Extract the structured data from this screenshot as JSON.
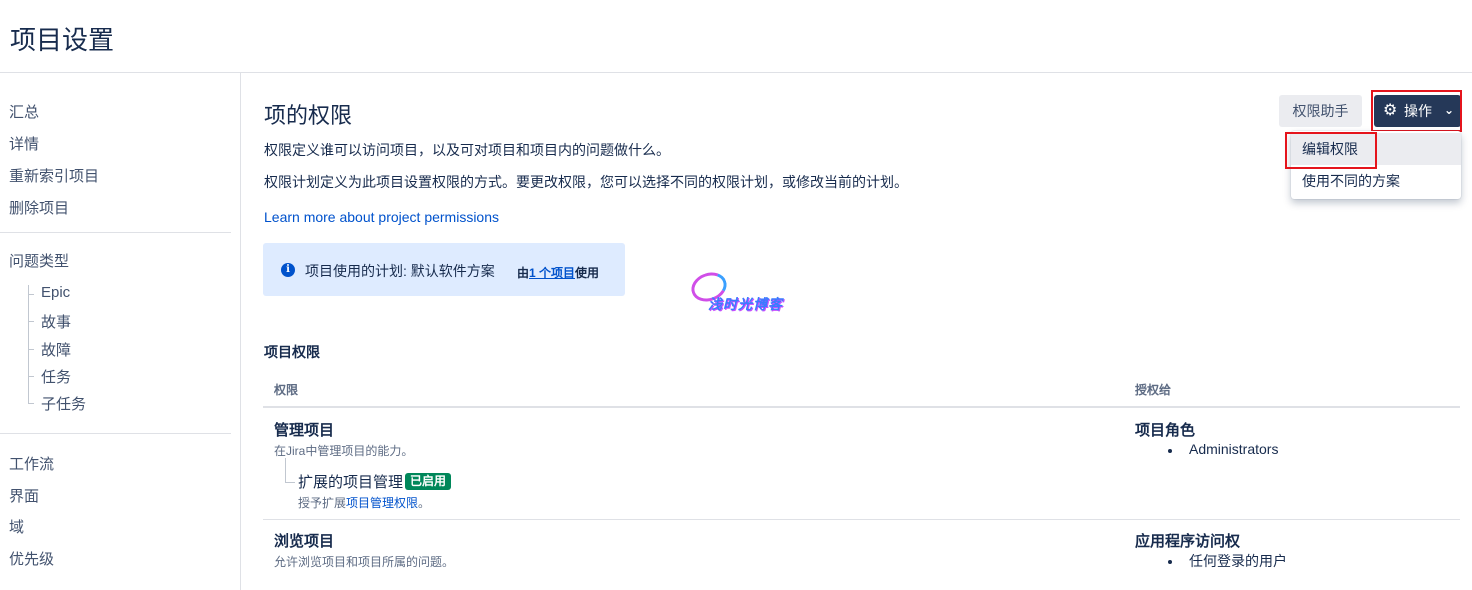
{
  "page": {
    "title": "项目设置"
  },
  "sidebar": {
    "items": [
      "汇总",
      "详情",
      "重新索引项目",
      "删除项目"
    ],
    "issue_types_label": "问题类型",
    "issue_types": [
      "Epic",
      "故事",
      "故障",
      "任务",
      "子任务"
    ],
    "items2": [
      "工作流",
      "界面",
      "域",
      "优先级"
    ]
  },
  "main": {
    "title": "项的权限",
    "desc1": "权限定义谁可以访问项目，以及可对项目和项目内的问题做什么。",
    "desc2": "权限计划定义为此项目设置权限的方式。要更改权限，您可以选择不同的权限计划，或修改当前的计划。",
    "learn_link": "Learn more about project permissions",
    "info": {
      "text": "项目使用的计划: 默认软件方案",
      "used_prefix": "由",
      "used_link": "1 个项目",
      "used_suffix": "使用"
    },
    "watermark": "浅时光博客"
  },
  "toolbar": {
    "helper_label": "权限助手",
    "ops_label": "操作",
    "dropdown": [
      "编辑权限",
      "使用不同的方案"
    ]
  },
  "permissions": {
    "heading": "项目权限",
    "col_permission": "权限",
    "col_granted": "授权给",
    "rows": [
      {
        "name": "管理项目",
        "desc": "在Jira中管理项目的能力。",
        "ext_name": "扩展的项目管理",
        "ext_badge": "已启用",
        "ext_desc_prefix": "授予扩展",
        "ext_desc_link": "项目管理权限",
        "ext_desc_suffix": "。",
        "grant_title": "项目角色",
        "grant_items": [
          "Administrators"
        ]
      },
      {
        "name": "浏览项目",
        "desc": "允许浏览项目和项目所属的问题。",
        "grant_title": "应用程序访问权",
        "grant_items": [
          "任何登录的用户"
        ]
      }
    ]
  },
  "colors": {
    "primary_button": "#253858",
    "link": "#0052cc",
    "badge": "#00875a",
    "info_bg": "#deebff",
    "highlight": "#e5141c"
  }
}
